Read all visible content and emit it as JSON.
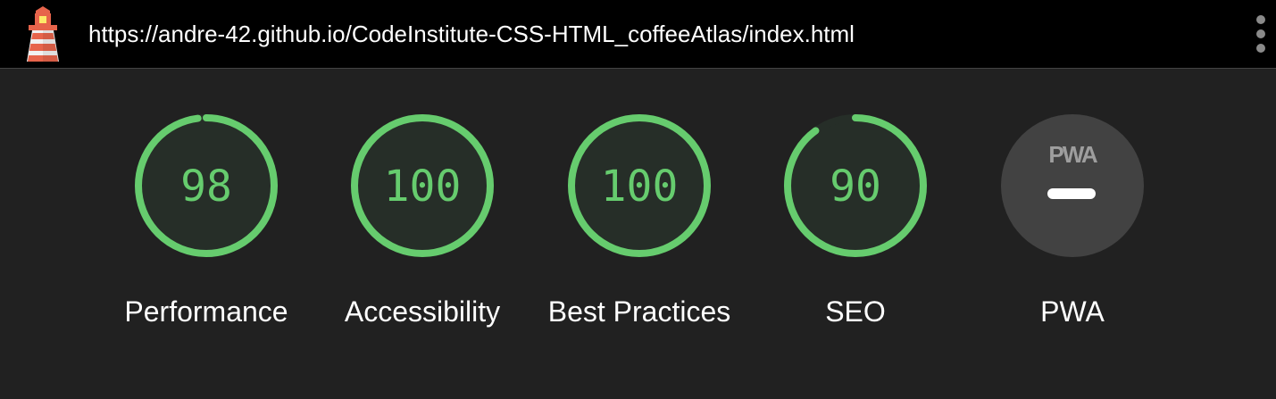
{
  "header": {
    "url": "https://andre-42.github.io/CodeInstitute-CSS-HTML_coffeeAtlas/index.html",
    "logo_icon": "lighthouse-icon",
    "menu_icon": "kebab-menu-icon"
  },
  "colors": {
    "pass": "#66cc6e",
    "pass_bg": "#262e28",
    "track": "#333333",
    "pwa_bg": "#424242",
    "pwa_fg": "#ffffff",
    "pwa_logo": "#9e9e9e"
  },
  "gauges": [
    {
      "label": "Performance",
      "score": 98
    },
    {
      "label": "Accessibility",
      "score": 100
    },
    {
      "label": "Best Practices",
      "score": 100
    },
    {
      "label": "SEO",
      "score": 90
    }
  ],
  "pwa": {
    "label": "PWA",
    "badge_text": "PWA",
    "icon": "pwa-badge-icon"
  }
}
